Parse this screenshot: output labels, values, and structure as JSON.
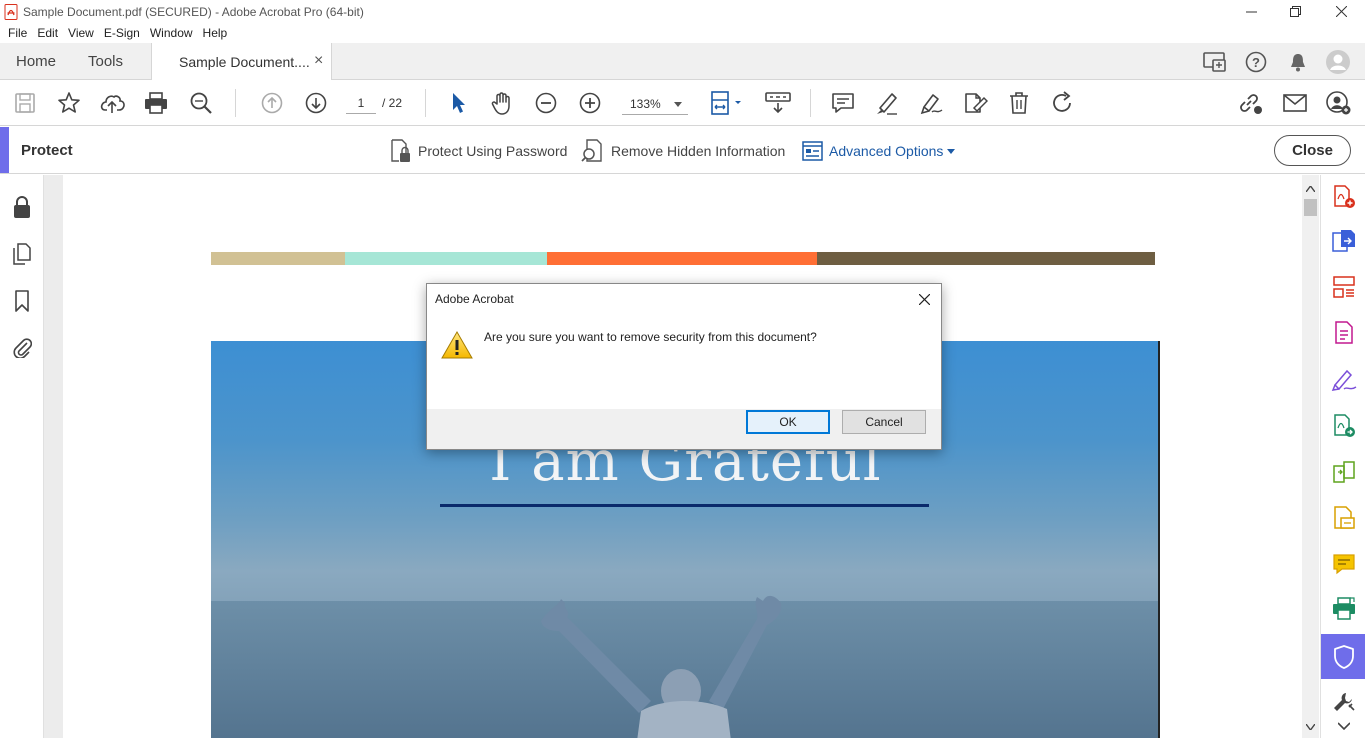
{
  "window": {
    "title": "Sample Document.pdf (SECURED) - Adobe Acrobat Pro (64-bit)"
  },
  "menu": [
    "File",
    "Edit",
    "View",
    "E-Sign",
    "Window",
    "Help"
  ],
  "tabs": {
    "home": "Home",
    "tools": "Tools",
    "document": "Sample Document....",
    "close_symbol": "×"
  },
  "toolbar": {
    "page_current": "1",
    "page_separator": "/ 22",
    "zoom": "133%"
  },
  "protect": {
    "title": "Protect",
    "protect_password": "Protect Using Password",
    "remove_hidden": "Remove Hidden Information",
    "advanced": "Advanced Options",
    "close_label": "Close"
  },
  "document": {
    "stripe_colors": [
      "#d1c194",
      "#a6e6d6",
      "#ff6f35",
      "#6e5e42"
    ],
    "hero_text": "I am Grateful"
  },
  "dialog": {
    "title": "Adobe Acrobat",
    "message": "Are you sure you want to remove security from this document?",
    "ok_label": "OK",
    "cancel_label": "Cancel"
  },
  "colors": {
    "accent": "#6f6dea",
    "link_blue": "#1c5aa6"
  }
}
